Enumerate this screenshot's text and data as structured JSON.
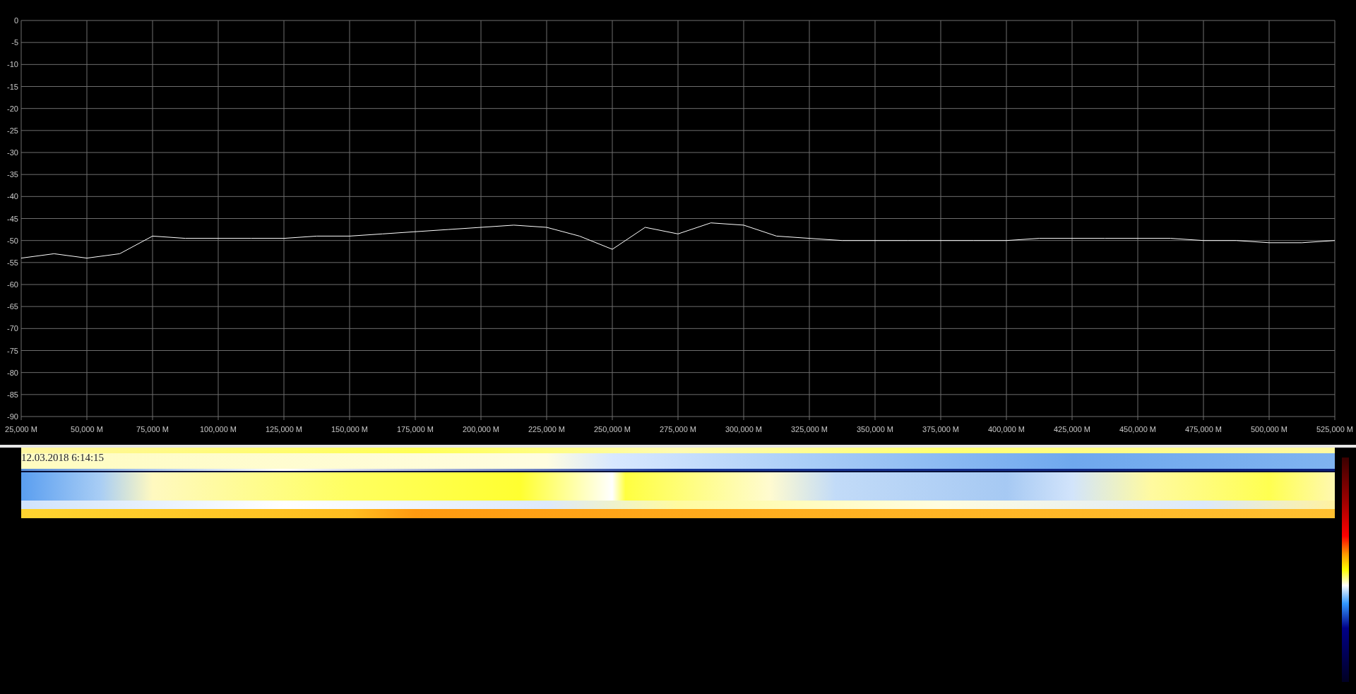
{
  "spectrum": {
    "chart_data": {
      "type": "line",
      "grid": true,
      "xlim": [
        25000,
        525000
      ],
      "ylim": [
        -90,
        0
      ],
      "xticks": [
        {
          "value": 25000,
          "label": "25,000 M"
        },
        {
          "value": 50000,
          "label": "50,000 M"
        },
        {
          "value": 75000,
          "label": "75,000 M"
        },
        {
          "value": 100000,
          "label": "100,000 M"
        },
        {
          "value": 125000,
          "label": "125,000 M"
        },
        {
          "value": 150000,
          "label": "150,000 M"
        },
        {
          "value": 175000,
          "label": "175,000 M"
        },
        {
          "value": 200000,
          "label": "200,000 M"
        },
        {
          "value": 225000,
          "label": "225,000 M"
        },
        {
          "value": 250000,
          "label": "250,000 M"
        },
        {
          "value": 275000,
          "label": "275,000 M"
        },
        {
          "value": 300000,
          "label": "300,000 M"
        },
        {
          "value": 325000,
          "label": "325,000 M"
        },
        {
          "value": 350000,
          "label": "350,000 M"
        },
        {
          "value": 375000,
          "label": "375,000 M"
        },
        {
          "value": 400000,
          "label": "400,000 M"
        },
        {
          "value": 425000,
          "label": "425,000 M"
        },
        {
          "value": 450000,
          "label": "450,000 M"
        },
        {
          "value": 475000,
          "label": "475,000 M"
        },
        {
          "value": 500000,
          "label": "500,000 M"
        },
        {
          "value": 525000,
          "label": "525,000 M"
        }
      ],
      "yticks": [
        0,
        -5,
        -10,
        -15,
        -20,
        -25,
        -30,
        -35,
        -40,
        -45,
        -50,
        -55,
        -60,
        -65,
        -70,
        -75,
        -80,
        -85,
        -90
      ],
      "x": [
        25000,
        37500,
        50000,
        62500,
        75000,
        87500,
        100000,
        112500,
        125000,
        137500,
        150000,
        162500,
        175000,
        187500,
        200000,
        212500,
        225000,
        237500,
        250000,
        262500,
        275000,
        287500,
        300000,
        312500,
        325000,
        337500,
        350000,
        362500,
        375000,
        387500,
        400000,
        412500,
        425000,
        437500,
        450000,
        462500,
        475000,
        487500,
        500000,
        512500,
        525000
      ],
      "series": [
        {
          "color": "#ffffff",
          "values": [
            -54,
            -53,
            -54,
            -53,
            -49,
            -49.5,
            -49.5,
            -49.5,
            -49.5,
            -49,
            -49,
            -48.5,
            -48,
            -47.5,
            -47,
            -46.5,
            -47,
            -49,
            -52,
            -47,
            -48.5,
            -46,
            -46.5,
            -49,
            -49.5,
            -50,
            -50,
            -50,
            -50,
            -50,
            -50,
            -49.5,
            -49.5,
            -49.5,
            -49.5,
            -49.5,
            -50,
            -50,
            -50.5,
            -50.5,
            -50
          ]
        }
      ]
    }
  },
  "waterfall": {
    "timestamp": "12.03.2018 6:14:15"
  }
}
